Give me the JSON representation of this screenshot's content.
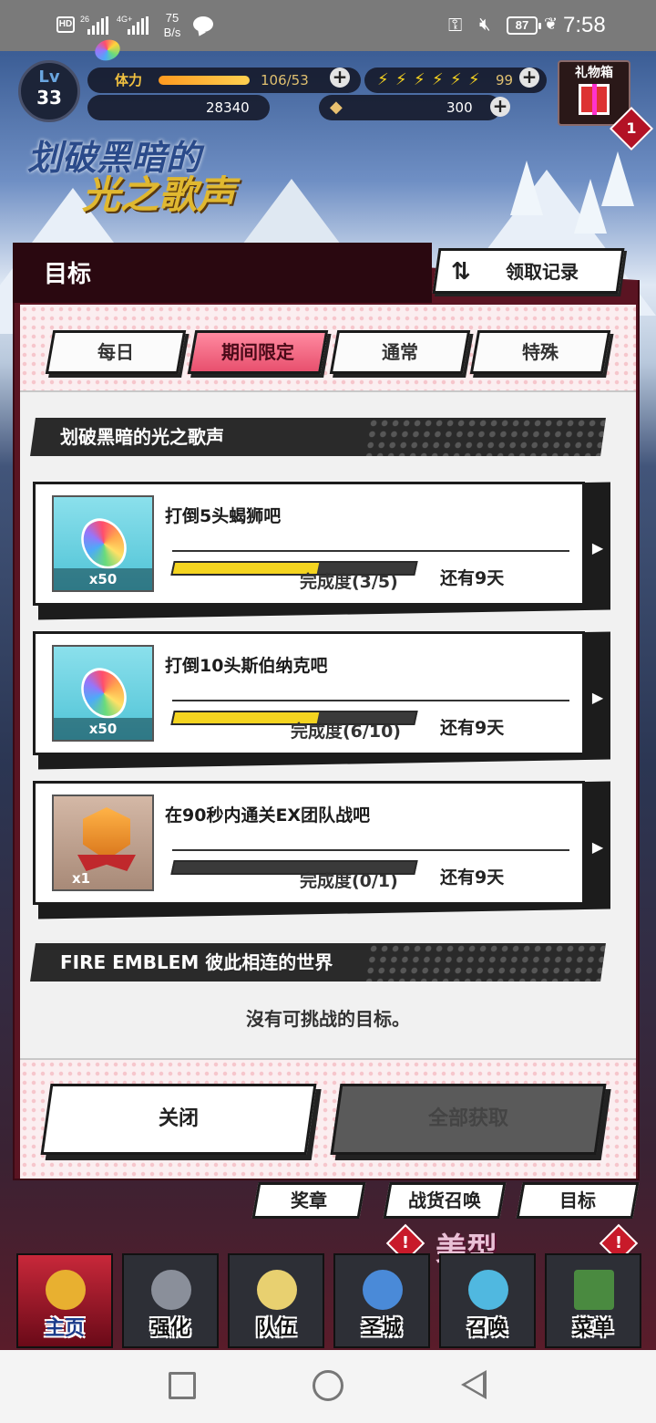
{
  "status_bar": {
    "hd": "HD",
    "sig1": "26",
    "sig2": "4G+",
    "speed_top": "75",
    "speed_bottom": "B/s",
    "battery": "87",
    "time": "7:58"
  },
  "hud": {
    "lv_label": "Lv",
    "level": "33",
    "stamina_label": "体力",
    "stamina_value": "106/53",
    "stamina_fill": 1.0,
    "feathers": "99",
    "orbs": "28340",
    "crystals": "300",
    "gift_label": "礼物箱",
    "gift_count": "1",
    "event_line1": "划破黑暗的",
    "event_line2": "光之歌声"
  },
  "modal": {
    "title": "目标",
    "records_label": "领取记录",
    "tabs": [
      {
        "label": "每日",
        "active": false
      },
      {
        "label": "期间限定",
        "active": true
      },
      {
        "label": "通常",
        "active": false
      },
      {
        "label": "特殊",
        "active": false
      }
    ],
    "section1": "划破黑暗的光之歌声",
    "quests": [
      {
        "title": "打倒5头蝎狮吧",
        "reward": "orb",
        "qty": "x50",
        "progress_text": "完成度(3/5)",
        "progress": 0.6,
        "remaining": "还有9天"
      },
      {
        "title": "打倒10头斯伯纳克吧",
        "reward": "orb",
        "qty": "x50",
        "progress_text": "完成度(6/10)",
        "progress": 0.6,
        "remaining": "还有9天"
      },
      {
        "title": "在90秒内通关EX团队战吧",
        "reward": "medal",
        "qty": "x1",
        "progress_text": "完成度(0/1)",
        "progress": 0.0,
        "remaining": "还有9天"
      }
    ],
    "section2": "FIRE EMBLEM 彼此相连的世界",
    "empty_text": "沒有可挑战的目标。",
    "close_label": "关闭",
    "claim_all_label": "全部获取"
  },
  "subnav": {
    "medal": "奖章",
    "summon_goods": "战货召唤",
    "goals": "目标",
    "meixing": "美型"
  },
  "bottom_nav": [
    {
      "label": "主页"
    },
    {
      "label": "强化"
    },
    {
      "label": "队伍"
    },
    {
      "label": "圣城"
    },
    {
      "label": "召唤"
    },
    {
      "label": "菜单"
    }
  ],
  "colors": {
    "active_tab": "#e8506e",
    "progress": "#f4d420",
    "modal_frame": "#5a1422"
  }
}
